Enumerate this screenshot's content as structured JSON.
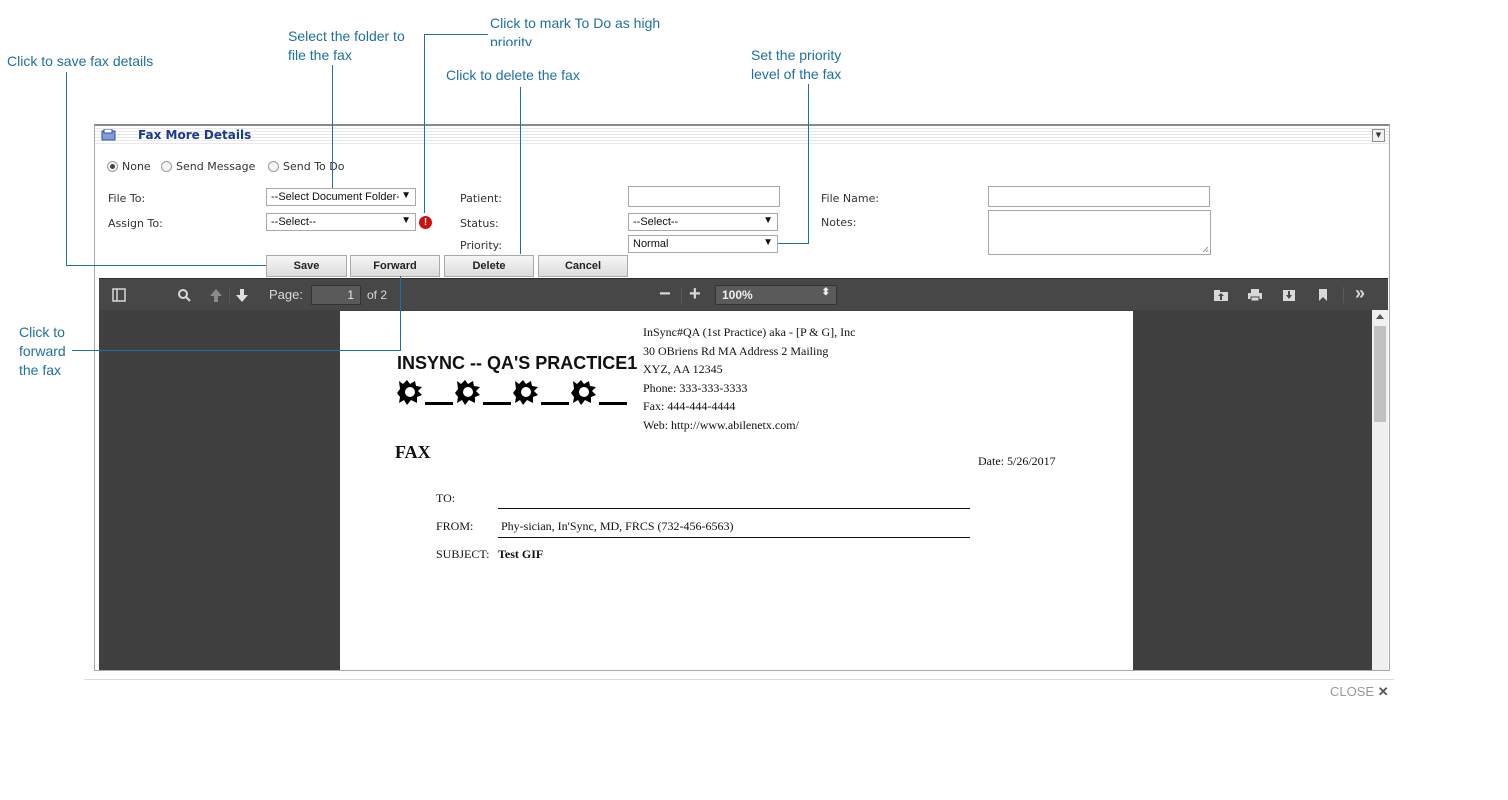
{
  "callouts": {
    "save": "Click to save fax details",
    "folder_line1": "Select the folder to",
    "folder_line2": "file the fax",
    "priority_todo_line1": "Click to mark To Do as high",
    "priority_todo_line2": "priority",
    "delete": "Click to delete the fax",
    "priority_line1": "Set the priority",
    "priority_line2": "level of the fax",
    "forward_line1": "Click to",
    "forward_line2": "forward",
    "forward_line3": "the fax"
  },
  "dialog": {
    "title": "Fax More Details",
    "radios": [
      {
        "label": "None",
        "checked": true
      },
      {
        "label": "Send Message",
        "checked": false
      },
      {
        "label": "Send To Do",
        "checked": false
      }
    ],
    "file_to_label": "File To:",
    "file_to_value": "--Select Document Folder--",
    "assign_to_label": "Assign To:",
    "assign_to_value": "--Select--",
    "patient_label": "Patient:",
    "status_label": "Status:",
    "status_value": "--Select--",
    "priority_label": "Priority:",
    "priority_value": "Normal",
    "file_name_label": "File Name:",
    "notes_label": "Notes:",
    "buttons": {
      "save": "Save",
      "forward": "Forward",
      "delete": "Delete",
      "cancel": "Cancel"
    },
    "close_label": "CLOSE"
  },
  "viewer": {
    "page_label": "Page:",
    "page_number": "1",
    "page_count": "of 2",
    "zoom": "100%"
  },
  "fax": {
    "practice_name": "INSYNC -- QA'S PRACTICE1",
    "address_lines": [
      "InSync#QA (1st Practice) aka - [P & G], Inc",
      "30 OBriens Rd MA Address 2 Mailing",
      "XYZ, AA 12345",
      "Phone: 333-333-3333",
      "Fax: 444-444-4444",
      "Web: http://www.abilenetx.com/"
    ],
    "heading": "FAX",
    "date": "Date: 5/26/2017",
    "to_label": "TO:",
    "from_label": "FROM:",
    "from_value": "Phy-sician, In'Sync, MD, FRCS (732-456-6563)",
    "subject_label": "SUBJECT:",
    "subject_value": "Test GIF"
  },
  "colors": {
    "callout": "#1f6fa3",
    "title": "#1a3a8c",
    "toolbar": "#474747",
    "viewer_bg": "#404040",
    "warn": "#cc1111"
  }
}
